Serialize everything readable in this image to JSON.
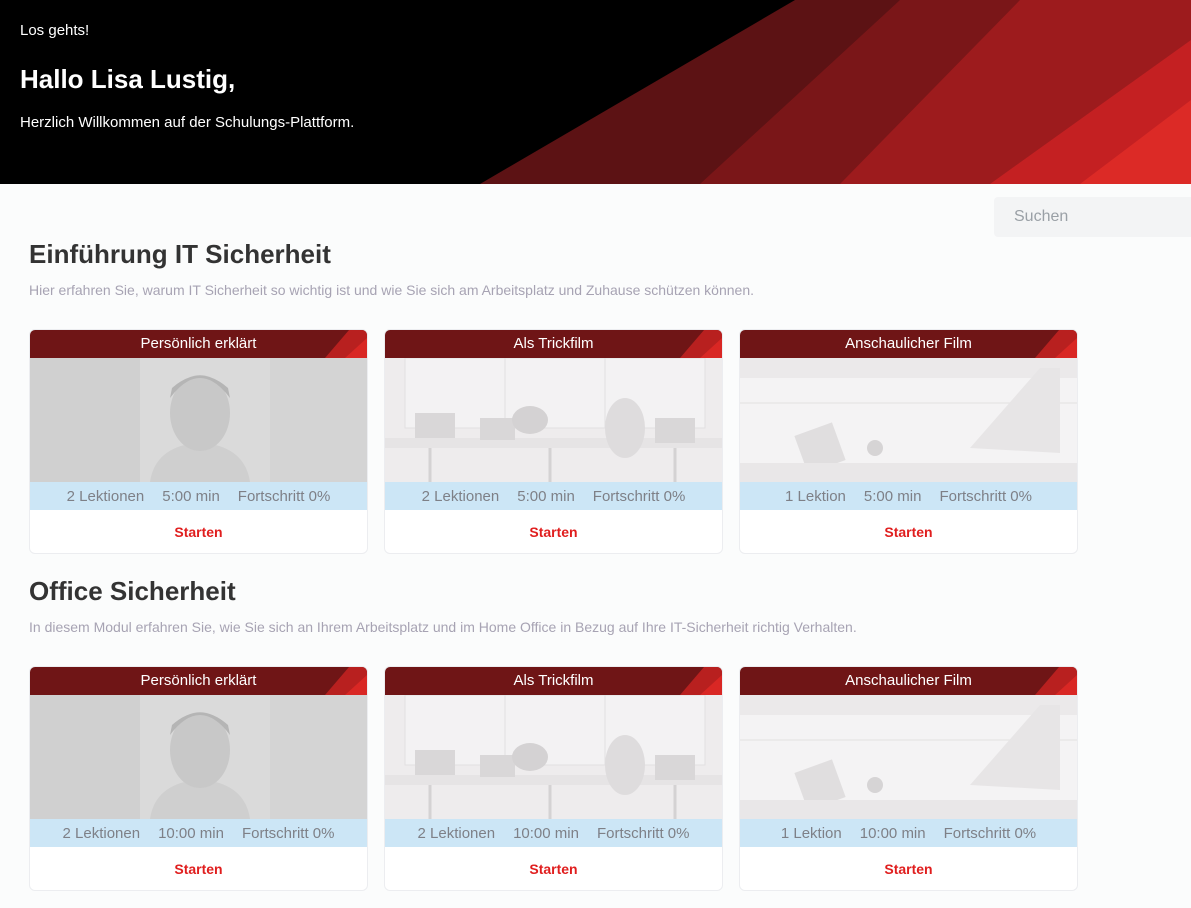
{
  "hero": {
    "kicker": "Los gehts!",
    "greeting": "Hallo Lisa Lustig,",
    "welcome": "Herzlich Willkommen auf der Schulungs-Plattform."
  },
  "search": {
    "placeholder": "Suchen"
  },
  "colors": {
    "accent": "#e01e1e",
    "header_red": "#6f1516",
    "meta_bg": "#cce6f6"
  },
  "sections": [
    {
      "title": "Einführung IT Sicherheit",
      "description": "Hier erfahren Sie, warum IT Sicherheit so wichtig ist und wie Sie sich am Arbeitsplatz und Zuhause schützen können.",
      "cards": [
        {
          "title": "Persönlich erklärt",
          "image": "person-portrait-icon",
          "lessons": "2 Lektionen",
          "duration": "5:00 min",
          "progress": "Fortschritt 0%",
          "action": "Starten"
        },
        {
          "title": "Als Trickfilm",
          "image": "office-illustration-icon",
          "lessons": "2 Lektionen",
          "duration": "5:00 min",
          "progress": "Fortschritt 0%",
          "action": "Starten"
        },
        {
          "title": "Anschaulicher Film",
          "image": "desk-photo-icon",
          "lessons": "1 Lektion",
          "duration": "5:00 min",
          "progress": "Fortschritt 0%",
          "action": "Starten"
        }
      ]
    },
    {
      "title": "Office Sicherheit",
      "description": "In diesem Modul erfahren Sie, wie Sie sich an Ihrem Arbeitsplatz und im Home Office in Bezug auf Ihre IT-Sicherheit richtig Verhalten.",
      "cards": [
        {
          "title": "Persönlich erklärt",
          "image": "person-portrait-icon",
          "lessons": "2 Lektionen",
          "duration": "10:00 min",
          "progress": "Fortschritt 0%",
          "action": "Starten"
        },
        {
          "title": "Als Trickfilm",
          "image": "office-illustration-icon",
          "lessons": "2 Lektionen",
          "duration": "10:00 min",
          "progress": "Fortschritt 0%",
          "action": "Starten"
        },
        {
          "title": "Anschaulicher Film",
          "image": "desk-photo-icon",
          "lessons": "1 Lektion",
          "duration": "10:00 min",
          "progress": "Fortschritt 0%",
          "action": "Starten"
        }
      ]
    }
  ]
}
